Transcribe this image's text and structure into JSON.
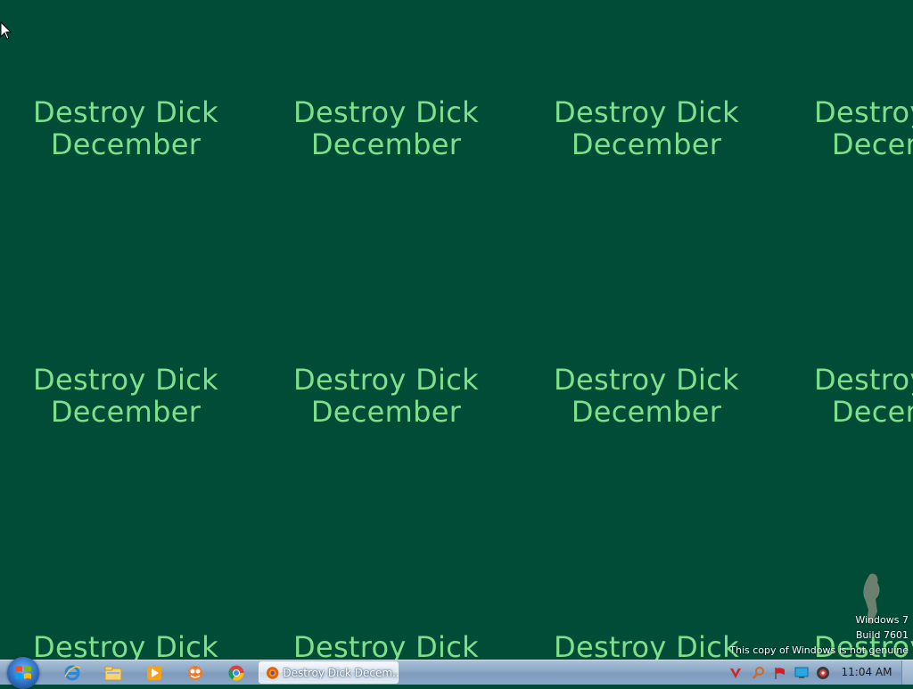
{
  "wallpaper": {
    "line1": "Destroy Dick",
    "line2": "December",
    "text_color": "#7ee08a",
    "background_color": "#004c36"
  },
  "watermark": {
    "line1": "Windows 7",
    "line2": "Build 7601",
    "line3": "This copy of Windows is not genuine"
  },
  "taskbar": {
    "pinned": [
      {
        "name": "internet-explorer-icon"
      },
      {
        "name": "windows-explorer-icon"
      },
      {
        "name": "media-player-icon"
      },
      {
        "name": "app-icon"
      },
      {
        "name": "chrome-icon"
      }
    ],
    "active_window": {
      "label": "Destroy Dick Decem...",
      "icon": "firefox-icon"
    },
    "tray_icons": [
      "antivirus-icon",
      "search-tool-icon",
      "flag-icon",
      "network-icon",
      "volume-icon"
    ],
    "clock": "11:04 AM"
  }
}
